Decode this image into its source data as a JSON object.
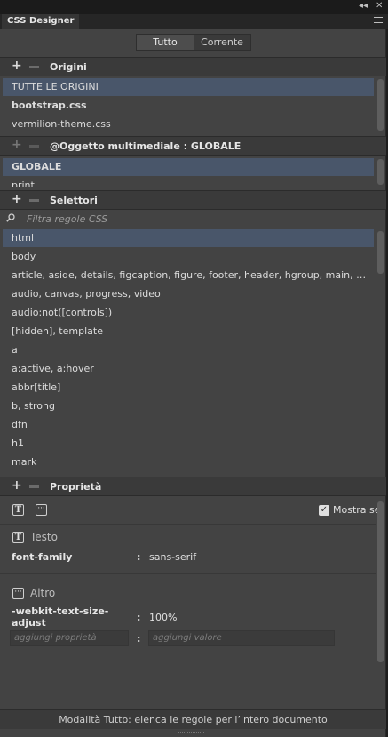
{
  "window": {
    "collapse_glyph": "◂◂",
    "close_glyph": "✕",
    "tab_title": "CSS Designer"
  },
  "mode_toggle": {
    "options": [
      "Tutto",
      "Corrente"
    ],
    "selected": "Tutto"
  },
  "sources": {
    "title": "Origini",
    "items": [
      "TUTTE LE ORIGINI",
      "bootstrap.css",
      "vermilion-theme.css"
    ]
  },
  "media": {
    "title": "@Oggetto multimediale :  GLOBALE",
    "items": [
      "GLOBALE",
      "print"
    ]
  },
  "selectors": {
    "title": "Selettori",
    "filter_placeholder": "Filtra regole CSS",
    "items": [
      "html",
      "body",
      "article, aside, details, figcaption, figure, footer, header, hgroup, main, menu, nav, section, summary",
      "audio, canvas, progress, video",
      "audio:not([controls])",
      "[hidden], template",
      "a",
      "a:active, a:hover",
      "abbr[title]",
      "b, strong",
      "dfn",
      "h1",
      "mark"
    ]
  },
  "properties": {
    "title": "Proprietà",
    "show_set_label": "Mostra set",
    "show_set_checked": true,
    "text_group": {
      "title": "Testo",
      "rows": [
        {
          "name": "font-family",
          "value": "sans-serif"
        }
      ]
    },
    "other_group": {
      "title": "Altro",
      "rows": [
        {
          "name": "-webkit-text-size-adjust",
          "value": "100%"
        }
      ],
      "add_property_placeholder": "aggiungi proprietà",
      "add_value_placeholder": "aggiungi valore"
    }
  },
  "status": "Modalità Tutto: elenca le regole per l’intero documento",
  "colors": {
    "panel_bg": "#434343",
    "header_bg": "#3a3a3a",
    "selection": "#49566a",
    "text": "#dcdcdc"
  },
  "icons": [
    "collapse-icon",
    "close-icon",
    "panel-menu-icon",
    "plus-icon",
    "minus-icon",
    "search-icon",
    "text-property-icon",
    "more-property-icon",
    "checkbox-icon"
  ]
}
